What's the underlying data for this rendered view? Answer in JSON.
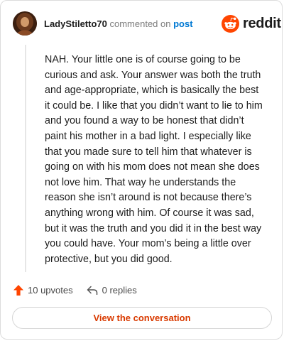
{
  "comment": {
    "username": "LadyStiletto70",
    "action_text": "commented on",
    "post_link": "post",
    "body": "NAH. Your little one is of course going to be curious and ask. Your answer was both the truth and age-appropriate, which is basically the best it could be. I like that you didn’t want to lie to him and you found a way to be honest that didn’t paint his mother in a bad light. I especially like that you made sure to tell him that whatever is going on with his mom does not mean she does not love him. That way he understands the reason she isn’t around is not because there’s anything wrong with him. Of course it was sad, but it was the truth and you did it in the best way you could have. Your mom’s being a little over protective, but you did good.",
    "upvotes_label": "10 upvotes",
    "replies_label": "0 replies"
  },
  "brand": {
    "wordmark": "reddit",
    "color": "#ff4500"
  },
  "cta": {
    "label": "View the conversation",
    "color": "#d93a00"
  },
  "icons": {
    "upvote": "upvote-arrow-icon",
    "reply": "reply-arrow-icon",
    "logo": "reddit-snoo-icon"
  }
}
